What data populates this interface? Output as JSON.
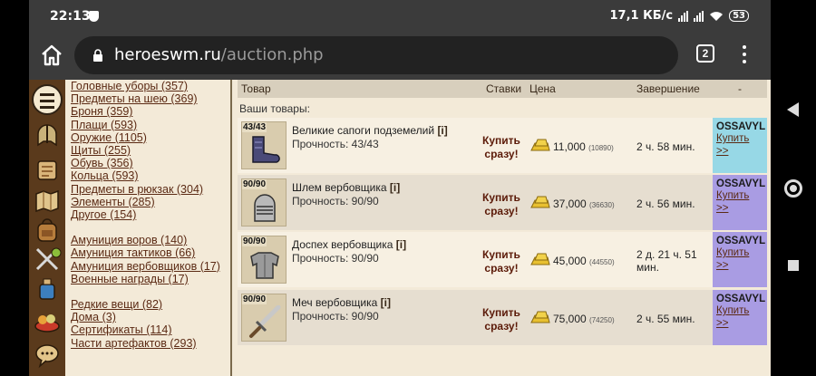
{
  "status_bar": {
    "time": "22:13",
    "net_speed": "17,1 КБ/с",
    "battery": "53"
  },
  "browser": {
    "url_host": "heroeswm.ru",
    "url_path": "/auction.php",
    "tab_count": "2"
  },
  "categories_group1": [
    "Головные уборы (357)",
    "Предметы на шею (369)",
    "Броня (359)",
    "Плащи (593)",
    "Оружие (1105)",
    "Щиты (255)",
    "Обувь (356)",
    "Кольца (593)",
    "Предметы в рюкзак (304)",
    "Элементы (285)",
    "Другое (154)"
  ],
  "categories_group2": [
    "Амуниция воров (140)",
    "Амуниция тактиков (66)",
    "Амуниция вербовщиков (17)",
    "Военные награды (17)"
  ],
  "categories_group3": [
    "Редкие вещи (82)",
    "Дома (3)",
    "Сертификаты (114)",
    "Части артефактов (293)"
  ],
  "table": {
    "col_item": "Товар",
    "col_bids": "Ставки",
    "col_price": "Цена",
    "col_end": "Завершение",
    "col_seller": "-",
    "your_goods": "Ваши товары:"
  },
  "lots": [
    {
      "durability": "43/43",
      "name": "Великие сапоги подземелий",
      "info": "[i]",
      "durability_text": "Прочность: 43/43",
      "buy_now_1": "Купить",
      "buy_now_2": "сразу!",
      "price": "11,000",
      "price_sub": "(10890)",
      "ends": "2 ч. 58 мин.",
      "seller": "OSSAVYL",
      "buy_1": "Купить",
      "buy_2": ">>"
    },
    {
      "durability": "90/90",
      "name": "Шлем вербовщика",
      "info": "[i]",
      "durability_text": "Прочность: 90/90",
      "buy_now_1": "Купить",
      "buy_now_2": "сразу!",
      "price": "37,000",
      "price_sub": "(36630)",
      "ends": "2 ч. 56 мин.",
      "seller": "OSSAVYL",
      "buy_1": "Купить",
      "buy_2": ">>"
    },
    {
      "durability": "90/90",
      "name": "Доспех вербовщика",
      "info": "[i]",
      "durability_text": "Прочность: 90/90",
      "buy_now_1": "Купить",
      "buy_now_2": "сразу!",
      "price": "45,000",
      "price_sub": "(44550)",
      "ends_1": "2 д. 21 ч. 51",
      "ends_2": "мин.",
      "seller": "OSSAVYL",
      "buy_1": "Купить",
      "buy_2": ">>"
    },
    {
      "durability": "90/90",
      "name": "Меч вербовщика",
      "info": "[i]",
      "durability_text": "Прочность: 90/90",
      "buy_now_1": "Купить",
      "buy_now_2": "сразу!",
      "price": "75,000",
      "price_sub": "(74250)",
      "ends": "2 ч. 55 мин.",
      "seller": "OSSAVYL",
      "buy_1": "Купить",
      "buy_2": ">>"
    }
  ],
  "colors": {
    "seller_cyan": "#97d8e6",
    "seller_lilac": "#a99ce3",
    "link": "#5b2a14"
  },
  "icons": [
    "menu-icon",
    "helmet-icon",
    "scroll-icon",
    "map-icon",
    "backpack-icon",
    "crossed-swords-icon",
    "potion-icon",
    "feast-icon",
    "chat-icon"
  ]
}
